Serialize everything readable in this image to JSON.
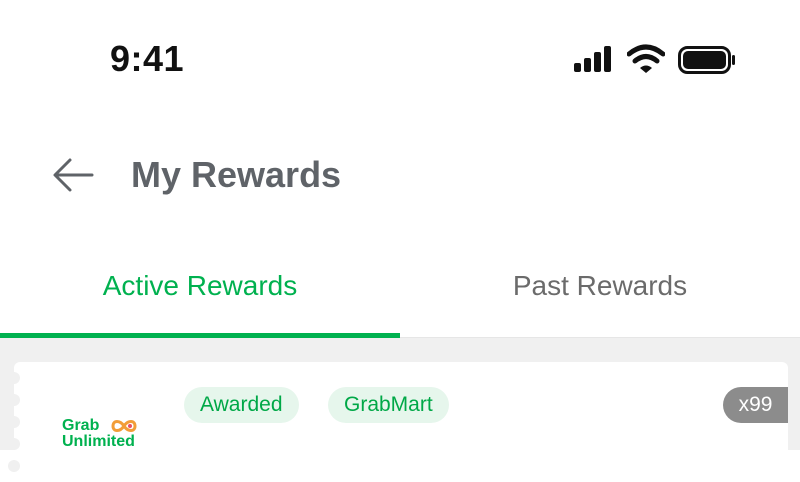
{
  "status_bar": {
    "time": "9:41",
    "signal_icon": "cellular-signal-icon",
    "wifi_icon": "wifi-icon",
    "battery_icon": "battery-icon"
  },
  "header": {
    "back_icon": "arrow-left-icon",
    "title": "My Rewards"
  },
  "tabs": [
    {
      "label": "Active Rewards",
      "active": true
    },
    {
      "label": "Past Rewards",
      "active": false
    }
  ],
  "colors": {
    "accent": "#00b14f",
    "badge_bg": "#e6f6ec",
    "muted_text": "#6b6b6b",
    "quantity_bg": "#8c8c8c",
    "content_bg": "#f0f0f0"
  },
  "reward_card": {
    "logo": {
      "line1": "Grab",
      "line2": "Unlimited",
      "icon": "infinity-icon"
    },
    "badges": [
      "Awarded",
      "GrabMart"
    ],
    "quantity": "x99"
  }
}
